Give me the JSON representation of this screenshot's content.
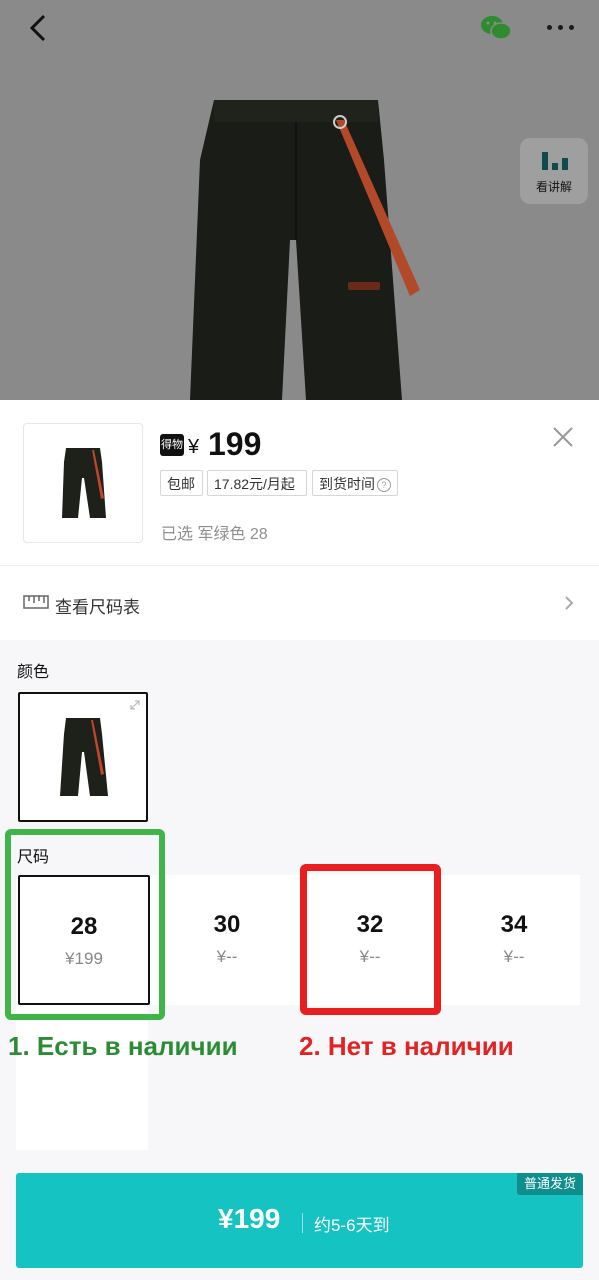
{
  "header": {
    "lecture_label": "看讲解"
  },
  "product": {
    "brand_logo_text": "得物",
    "currency": "¥",
    "price": "199",
    "tags": [
      "包邮",
      "17.82元/月起",
      "到货时间"
    ],
    "selected_text": "已选 军绿色 28"
  },
  "size_chart": {
    "label": "查看尺码表"
  },
  "color_section": {
    "label": "颜色"
  },
  "size_section": {
    "label": "尺码",
    "sizes": [
      {
        "size": "28",
        "price": "¥199",
        "selected": true
      },
      {
        "size": "30",
        "price": "¥--",
        "selected": false
      },
      {
        "size": "32",
        "price": "¥--",
        "selected": false
      },
      {
        "size": "34",
        "price": "¥--",
        "selected": false
      }
    ]
  },
  "annotations": {
    "in_stock": "1. Есть в наличии",
    "out_of_stock": "2. Нет в наличии"
  },
  "buy_button": {
    "badge": "普通发货",
    "price": "¥199",
    "eta": "约5-6天到"
  },
  "colors": {
    "accent": "#15c3c2",
    "annotation_green": "#3eb449",
    "annotation_red": "#e91f1f"
  }
}
